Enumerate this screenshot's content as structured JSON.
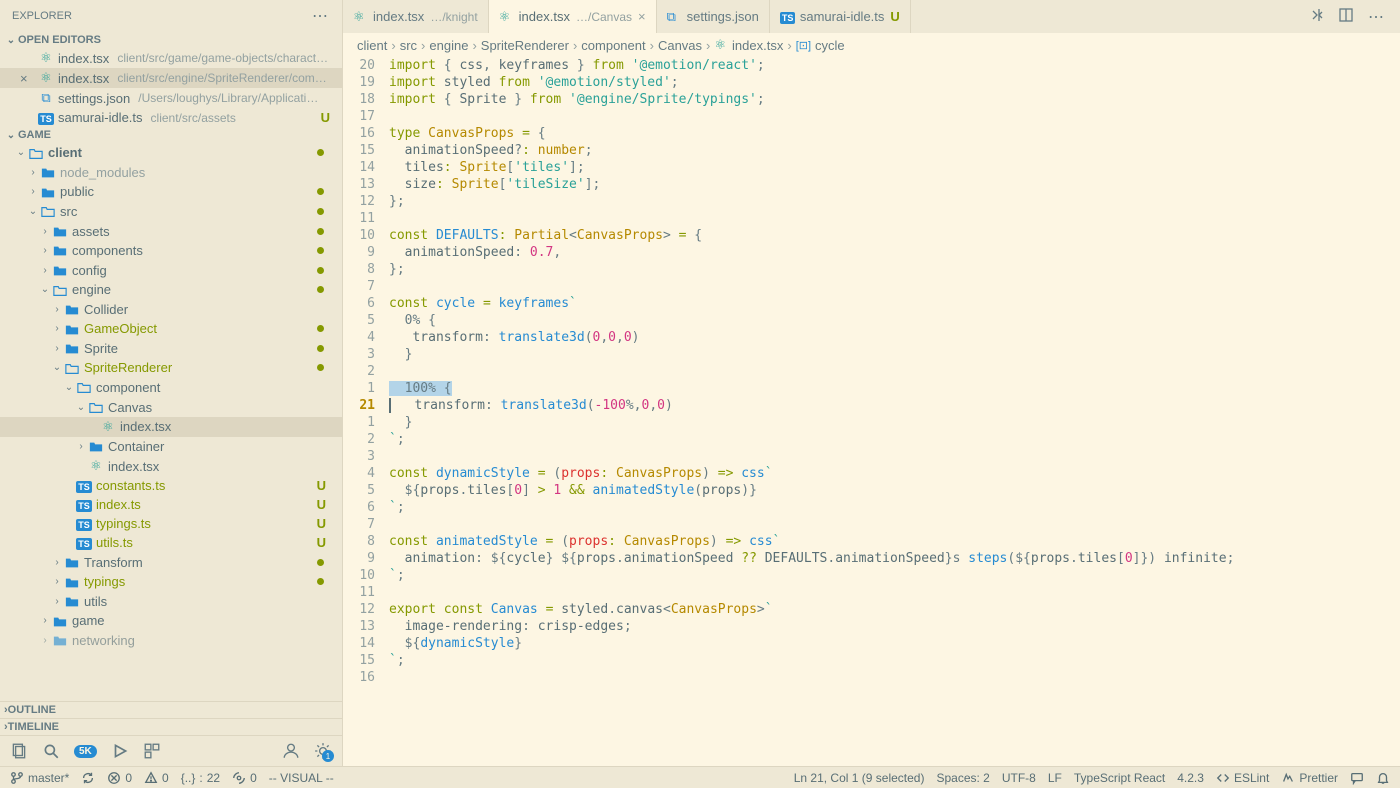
{
  "sidebar": {
    "title": "EXPLORER",
    "sections": {
      "openEditors": {
        "title": "OPEN EDITORS",
        "items": [
          {
            "name": "index.tsx",
            "path": "client/src/game/game-objects/charact…",
            "icon": "react"
          },
          {
            "name": "index.tsx",
            "path": "client/src/engine/SpriteRenderer/com…",
            "icon": "react",
            "active": true
          },
          {
            "name": "settings.json",
            "path": "/Users/loughys/Library/Applicati…",
            "icon": "vscode"
          },
          {
            "name": "samurai-idle.ts",
            "path": "client/src/assets",
            "icon": "ts",
            "badge": "U"
          }
        ]
      },
      "game": {
        "title": "GAME"
      },
      "outline": "OUTLINE",
      "timeline": "TIMELINE"
    },
    "tree": [
      {
        "label": "client",
        "depth": 0,
        "open": true,
        "folder": true,
        "dot": true,
        "bold": true
      },
      {
        "label": "node_modules",
        "depth": 1,
        "folder": true,
        "muted": true
      },
      {
        "label": "public",
        "depth": 1,
        "folder": true,
        "dot": true
      },
      {
        "label": "src",
        "depth": 1,
        "folder": true,
        "open": true,
        "dot": true
      },
      {
        "label": "assets",
        "depth": 2,
        "folder": true,
        "dot": true
      },
      {
        "label": "components",
        "depth": 2,
        "folder": true,
        "dot": true
      },
      {
        "label": "config",
        "depth": 2,
        "folder": true,
        "dot": true
      },
      {
        "label": "engine",
        "depth": 2,
        "folder": true,
        "open": true,
        "dot": true
      },
      {
        "label": "Collider",
        "depth": 3,
        "folder": true
      },
      {
        "label": "GameObject",
        "depth": 3,
        "folder": true,
        "dot": true,
        "green": true
      },
      {
        "label": "Sprite",
        "depth": 3,
        "folder": true,
        "dot": true
      },
      {
        "label": "SpriteRenderer",
        "depth": 3,
        "folder": true,
        "open": true,
        "dot": true,
        "green": true
      },
      {
        "label": "component",
        "depth": 4,
        "folder": true,
        "open": true
      },
      {
        "label": "Canvas",
        "depth": 5,
        "folder": true,
        "open": true
      },
      {
        "label": "index.tsx",
        "depth": 6,
        "icon": "react",
        "active": true
      },
      {
        "label": "Container",
        "depth": 5,
        "folder": true
      },
      {
        "label": "index.tsx",
        "depth": 5,
        "icon": "react"
      },
      {
        "label": "constants.ts",
        "depth": 4,
        "icon": "ts",
        "badge": "U",
        "green": true
      },
      {
        "label": "index.ts",
        "depth": 4,
        "icon": "ts",
        "badge": "U",
        "green": true
      },
      {
        "label": "typings.ts",
        "depth": 4,
        "icon": "ts",
        "badge": "U",
        "green": true
      },
      {
        "label": "utils.ts",
        "depth": 4,
        "icon": "ts",
        "badge": "U",
        "green": true
      },
      {
        "label": "Transform",
        "depth": 3,
        "folder": true,
        "dot": true
      },
      {
        "label": "typings",
        "depth": 3,
        "folder": true,
        "dot": true,
        "green": true
      },
      {
        "label": "utils",
        "depth": 3,
        "folder": true
      },
      {
        "label": "game",
        "depth": 2,
        "folder": true
      },
      {
        "label": "networking",
        "depth": 2,
        "folder": true,
        "cut": true
      }
    ]
  },
  "tabs": [
    {
      "name": "index.tsx",
      "hint": "…/knight",
      "icon": "react"
    },
    {
      "name": "index.tsx",
      "hint": "…/Canvas",
      "icon": "react",
      "active": true,
      "close": true
    },
    {
      "name": "settings.json",
      "icon": "vscode"
    },
    {
      "name": "samurai-idle.ts",
      "icon": "ts",
      "badge": "U"
    }
  ],
  "breadcrumb": [
    "client",
    "src",
    "engine",
    "SpriteRenderer",
    "component",
    "Canvas",
    "index.tsx",
    "cycle"
  ],
  "breadcrumbLastIcon": "symbol",
  "gutter": [
    "20",
    "19",
    "18",
    "17",
    "16",
    "15",
    "14",
    "13",
    "12",
    "11",
    "10",
    "9",
    "8",
    "7",
    "6",
    "5",
    "4",
    "3",
    "2",
    "1",
    "21",
    "1",
    "2",
    "3",
    "4",
    "5",
    "6",
    "7",
    "8",
    "9",
    "10",
    "11",
    "12",
    "13",
    "14",
    "15",
    "16"
  ],
  "gutterCurrentIndex": 20,
  "code": [
    [
      [
        "kw",
        "import"
      ],
      [
        "punc",
        " { "
      ],
      [
        "prop",
        "css"
      ],
      [
        "punc",
        ", "
      ],
      [
        "prop",
        "keyframes"
      ],
      [
        "punc",
        " } "
      ],
      [
        "kw",
        "from"
      ],
      [
        "punc",
        " "
      ],
      [
        "str",
        "'@emotion/react'"
      ],
      [
        "punc",
        ";"
      ]
    ],
    [
      [
        "kw",
        "import"
      ],
      [
        "punc",
        " "
      ],
      [
        "prop",
        "styled"
      ],
      [
        "punc",
        " "
      ],
      [
        "kw",
        "from"
      ],
      [
        "punc",
        " "
      ],
      [
        "str",
        "'@emotion/styled'"
      ],
      [
        "punc",
        ";"
      ]
    ],
    [
      [
        "kw",
        "import"
      ],
      [
        "punc",
        " { "
      ],
      [
        "prop",
        "Sprite"
      ],
      [
        "punc",
        " } "
      ],
      [
        "kw",
        "from"
      ],
      [
        "punc",
        " "
      ],
      [
        "str",
        "'@engine/Sprite/typings'"
      ],
      [
        "punc",
        ";"
      ]
    ],
    [],
    [
      [
        "kw",
        "type"
      ],
      [
        "punc",
        " "
      ],
      [
        "type",
        "CanvasProps"
      ],
      [
        "punc",
        " "
      ],
      [
        "kw",
        "="
      ],
      [
        "punc",
        " {"
      ]
    ],
    [
      [
        "punc",
        "  "
      ],
      [
        "prop",
        "animationSpeed"
      ],
      [
        "punc",
        "?"
      ],
      [
        "kw",
        ":"
      ],
      [
        "punc",
        " "
      ],
      [
        "type",
        "number"
      ],
      [
        "punc",
        ";"
      ]
    ],
    [
      [
        "punc",
        "  "
      ],
      [
        "prop",
        "tiles"
      ],
      [
        "kw",
        ":"
      ],
      [
        "punc",
        " "
      ],
      [
        "type",
        "Sprite"
      ],
      [
        "punc",
        "["
      ],
      [
        "str",
        "'tiles'"
      ],
      [
        "punc",
        "];"
      ]
    ],
    [
      [
        "punc",
        "  "
      ],
      [
        "prop",
        "size"
      ],
      [
        "kw",
        ":"
      ],
      [
        "punc",
        " "
      ],
      [
        "type",
        "Sprite"
      ],
      [
        "punc",
        "["
      ],
      [
        "str",
        "'tileSize'"
      ],
      [
        "punc",
        "];"
      ]
    ],
    [
      [
        "punc",
        "};"
      ]
    ],
    [],
    [
      [
        "kw",
        "const"
      ],
      [
        "punc",
        " "
      ],
      [
        "var",
        "DEFAULTS"
      ],
      [
        "kw",
        ":"
      ],
      [
        "punc",
        " "
      ],
      [
        "type",
        "Partial"
      ],
      [
        "punc",
        "<"
      ],
      [
        "type",
        "CanvasProps"
      ],
      [
        "punc",
        ">"
      ],
      [
        "punc",
        " "
      ],
      [
        "kw",
        "="
      ],
      [
        "punc",
        " {"
      ]
    ],
    [
      [
        "punc",
        "  "
      ],
      [
        "prop",
        "animationSpeed"
      ],
      [
        "punc",
        ": "
      ],
      [
        "num",
        "0.7"
      ],
      [
        "punc",
        ","
      ]
    ],
    [
      [
        "punc",
        "};"
      ]
    ],
    [],
    [
      [
        "kw",
        "const"
      ],
      [
        "punc",
        " "
      ],
      [
        "var",
        "cycle"
      ],
      [
        "punc",
        " "
      ],
      [
        "kw",
        "="
      ],
      [
        "punc",
        " "
      ],
      [
        "fn",
        "keyframes"
      ],
      [
        "str",
        "`"
      ]
    ],
    [
      [
        "punc",
        "  0% {"
      ]
    ],
    [
      [
        "punc",
        "   "
      ],
      [
        "prop",
        "transform"
      ],
      [
        "punc",
        ": "
      ],
      [
        "fn",
        "translate3d"
      ],
      [
        "punc",
        "("
      ],
      [
        "num",
        "0"
      ],
      [
        "punc",
        ","
      ],
      [
        "num",
        "0"
      ],
      [
        "punc",
        ","
      ],
      [
        "num",
        "0"
      ],
      [
        "punc",
        ")"
      ]
    ],
    [
      [
        "punc",
        "  }"
      ]
    ],
    [],
    [
      [
        "sel",
        "  100% {"
      ]
    ],
    [
      [
        "cursor",
        ""
      ],
      [
        "punc",
        "   "
      ],
      [
        "prop",
        "transform"
      ],
      [
        "punc",
        ": "
      ],
      [
        "fn",
        "translate3d"
      ],
      [
        "punc",
        "("
      ],
      [
        "num",
        "-100"
      ],
      [
        "punc",
        "%,"
      ],
      [
        "num",
        "0"
      ],
      [
        "punc",
        ","
      ],
      [
        "num",
        "0"
      ],
      [
        "punc",
        ")"
      ]
    ],
    [
      [
        "punc",
        "  }"
      ]
    ],
    [
      [
        "str",
        "`"
      ],
      [
        "punc",
        ";"
      ]
    ],
    [],
    [
      [
        "kw",
        "const"
      ],
      [
        "punc",
        " "
      ],
      [
        "var",
        "dynamicStyle"
      ],
      [
        "punc",
        " "
      ],
      [
        "kw",
        "="
      ],
      [
        "punc",
        " ("
      ],
      [
        "param",
        "props"
      ],
      [
        "kw",
        ":"
      ],
      [
        "punc",
        " "
      ],
      [
        "type",
        "CanvasProps"
      ],
      [
        "punc",
        ") "
      ],
      [
        "kw",
        "=>"
      ],
      [
        "punc",
        " "
      ],
      [
        "fn",
        "css"
      ],
      [
        "str",
        "`"
      ]
    ],
    [
      [
        "punc",
        "  ${"
      ],
      [
        "prop",
        "props"
      ],
      [
        "punc",
        "."
      ],
      [
        "prop",
        "tiles"
      ],
      [
        "punc",
        "["
      ],
      [
        "num",
        "0"
      ],
      [
        "punc",
        "] "
      ],
      [
        "kw",
        ">"
      ],
      [
        "punc",
        " "
      ],
      [
        "num",
        "1"
      ],
      [
        "punc",
        " "
      ],
      [
        "kw",
        "&&"
      ],
      [
        "punc",
        " "
      ],
      [
        "fn",
        "animatedStyle"
      ],
      [
        "punc",
        "("
      ],
      [
        "prop",
        "props"
      ],
      [
        "punc",
        ")"
      ],
      [
        "punc",
        "}"
      ]
    ],
    [
      [
        "str",
        "`"
      ],
      [
        "punc",
        ";"
      ]
    ],
    [],
    [
      [
        "kw",
        "const"
      ],
      [
        "punc",
        " "
      ],
      [
        "var",
        "animatedStyle"
      ],
      [
        "punc",
        " "
      ],
      [
        "kw",
        "="
      ],
      [
        "punc",
        " ("
      ],
      [
        "param",
        "props"
      ],
      [
        "kw",
        ":"
      ],
      [
        "punc",
        " "
      ],
      [
        "type",
        "CanvasProps"
      ],
      [
        "punc",
        ") "
      ],
      [
        "kw",
        "=>"
      ],
      [
        "punc",
        " "
      ],
      [
        "fn",
        "css"
      ],
      [
        "str",
        "`"
      ]
    ],
    [
      [
        "punc",
        "  "
      ],
      [
        "prop",
        "animation"
      ],
      [
        "punc",
        ": ${"
      ],
      [
        "prop",
        "cycle"
      ],
      [
        "punc",
        "} ${"
      ],
      [
        "prop",
        "props"
      ],
      [
        "punc",
        "."
      ],
      [
        "prop",
        "animationSpeed"
      ],
      [
        "punc",
        " "
      ],
      [
        "kw",
        "??"
      ],
      [
        "punc",
        " "
      ],
      [
        "prop",
        "DEFAULTS"
      ],
      [
        "punc",
        "."
      ],
      [
        "prop",
        "animationSpeed"
      ],
      [
        "punc",
        "}s "
      ],
      [
        "fn",
        "steps"
      ],
      [
        "punc",
        "(${"
      ],
      [
        "prop",
        "props"
      ],
      [
        "punc",
        "."
      ],
      [
        "prop",
        "tiles"
      ],
      [
        "punc",
        "["
      ],
      [
        "num",
        "0"
      ],
      [
        "punc",
        "]}) "
      ],
      [
        "prop",
        "infinite"
      ],
      [
        "punc",
        ";"
      ]
    ],
    [
      [
        "str",
        "`"
      ],
      [
        "punc",
        ";"
      ]
    ],
    [],
    [
      [
        "kw",
        "export"
      ],
      [
        "punc",
        " "
      ],
      [
        "kw",
        "const"
      ],
      [
        "punc",
        " "
      ],
      [
        "var",
        "Canvas"
      ],
      [
        "punc",
        " "
      ],
      [
        "kw",
        "="
      ],
      [
        "punc",
        " "
      ],
      [
        "prop",
        "styled"
      ],
      [
        "punc",
        "."
      ],
      [
        "prop",
        "canvas"
      ],
      [
        "punc",
        "<"
      ],
      [
        "type",
        "CanvasProps"
      ],
      [
        "punc",
        ">"
      ],
      [
        "str",
        "`"
      ]
    ],
    [
      [
        "punc",
        "  "
      ],
      [
        "prop",
        "image-rendering"
      ],
      [
        "punc",
        ": "
      ],
      [
        "prop",
        "crisp-edges"
      ],
      [
        "punc",
        ";"
      ]
    ],
    [
      [
        "punc",
        "  ${"
      ],
      [
        "fn",
        "dynamicStyle"
      ],
      [
        "punc",
        "}"
      ]
    ],
    [
      [
        "str",
        "`"
      ],
      [
        "punc",
        ";"
      ]
    ],
    []
  ],
  "statusbar": {
    "branch": "master*",
    "sync": "",
    "errors": "0",
    "warnings": "0",
    "brackets": "{..}",
    "bracketsCount": "22",
    "port": "0",
    "mode": "-- VISUAL --",
    "position": "Ln 21, Col 1 (9 selected)",
    "spaces": "Spaces: 2",
    "encoding": "UTF-8",
    "eol": "LF",
    "lang": "TypeScript React",
    "version": "4.2.3",
    "eslint": "ESLint",
    "prettier": "Prettier"
  },
  "icons": {
    "react": "⚛",
    "ts": "TS",
    "vscode": "⧉",
    "folder": "▸",
    "folderOpen": "▾"
  }
}
